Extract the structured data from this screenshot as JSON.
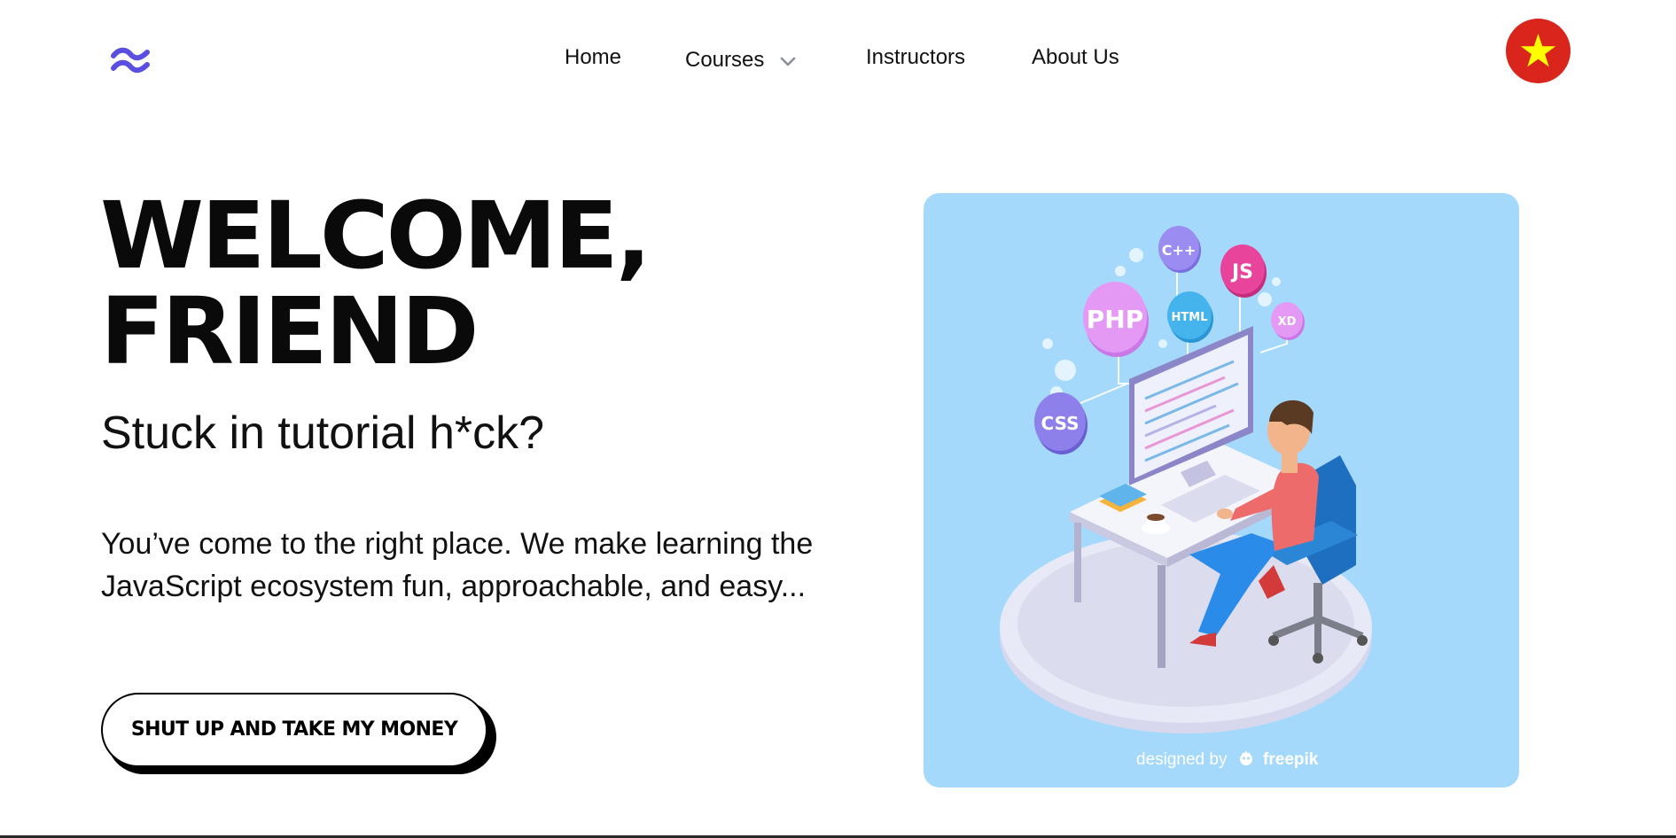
{
  "header": {
    "logo_icon": "tailwind-wave-icon",
    "nav": {
      "home": "Home",
      "courses": "Courses",
      "instructors": "Instructors",
      "about": "About Us"
    },
    "language_flag": "vietnam-flag-icon"
  },
  "hero": {
    "title_line1": "WELCOME,",
    "title_line2": "FRIEND",
    "subtitle": "Stuck in tutorial h*ck?",
    "description": "You’ve come to the right place. We make learning the JavaScript ecosystem fun, approachable, and easy...",
    "cta_label": "SHUT UP AND TAKE MY MONEY"
  },
  "illustration": {
    "badges": [
      "PHP",
      "C++",
      "JS",
      "HTML",
      "XD",
      "CSS"
    ],
    "credit_prefix": "designed by",
    "credit_brand": "freepik"
  },
  "colors": {
    "logo": "#5a4fe0",
    "illustration_bg": "#a5d9fb",
    "flag_red": "#da251d",
    "flag_star": "#ffff00"
  }
}
